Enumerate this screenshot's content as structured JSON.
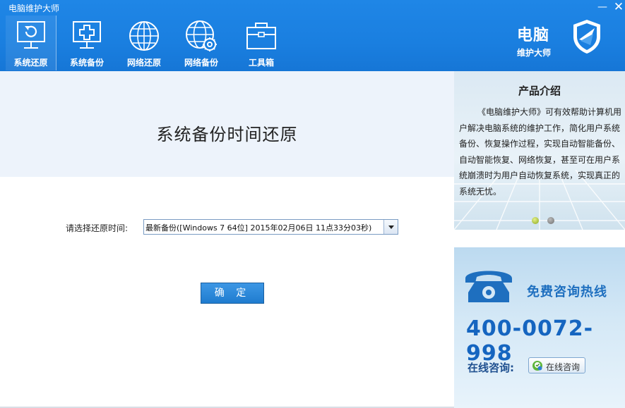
{
  "window": {
    "title": "电脑维护大师",
    "minimize_glyph": "—",
    "close_glyph": "✕"
  },
  "tabs": [
    {
      "label": "系统还原",
      "icon": "monitor-restore-icon",
      "active": true
    },
    {
      "label": "系统备份",
      "icon": "monitor-plus-icon",
      "active": false
    },
    {
      "label": "网络还原",
      "icon": "globe-icon",
      "active": false
    },
    {
      "label": "网络备份",
      "icon": "globe-gear-icon",
      "active": false
    },
    {
      "label": "工具箱",
      "icon": "toolbox-icon",
      "active": false
    }
  ],
  "brand": {
    "line1": "电脑",
    "line2": "维护大师",
    "icon": "shield-icon"
  },
  "main": {
    "heading": "系统备份时间还原",
    "restore_label": "请选择还原时间:",
    "restore_selected": "最新备份([Windows 7 64位] 2015年02月06日 11点33分03秒)",
    "confirm_label": "确 定"
  },
  "intro": {
    "title": "产品介绍",
    "text": "《电脑维护大师》可有效帮助计算机用户解决电脑系统的维护工作，简化用户系统备份、恢复操作过程，实现自动智能备份、自动智能恢复、网络恢复，甚至可在用户系统崩溃时为用户自动恢复系统，实现真正的系统无忧。",
    "carousel_index": 1,
    "carousel_count": 2
  },
  "hotline": {
    "title": "免费咨询热线",
    "number": "400-0072-998",
    "online_label": "在线咨询:",
    "online_button": "在线咨询",
    "icon": "phone-icon"
  },
  "colors": {
    "topbar": "#1a7fe0",
    "accent": "#1565c0",
    "button": "#2b88d8"
  }
}
